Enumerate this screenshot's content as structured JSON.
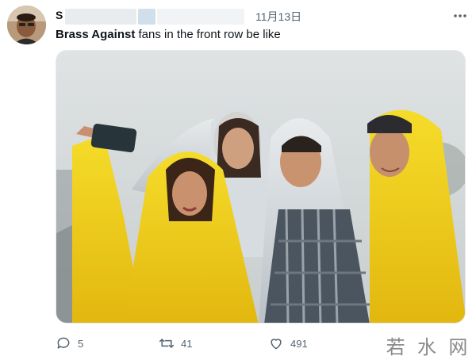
{
  "user": {
    "name_initial": "S",
    "avatar_alt": "avatar"
  },
  "date": "11月13日",
  "tweet": {
    "mention": "Brass Against",
    "text": " fans in the front row be like"
  },
  "actions": {
    "reply_count": "5",
    "retweet_count": "41",
    "like_count": "491"
  },
  "watermark": {
    "chars": [
      "若",
      "水",
      "网"
    ]
  },
  "colors": {
    "text_primary": "#0f1419",
    "text_secondary": "#536471",
    "poncho_yellow": "#f2d21b",
    "sky_grey": "#dfe3e4"
  }
}
